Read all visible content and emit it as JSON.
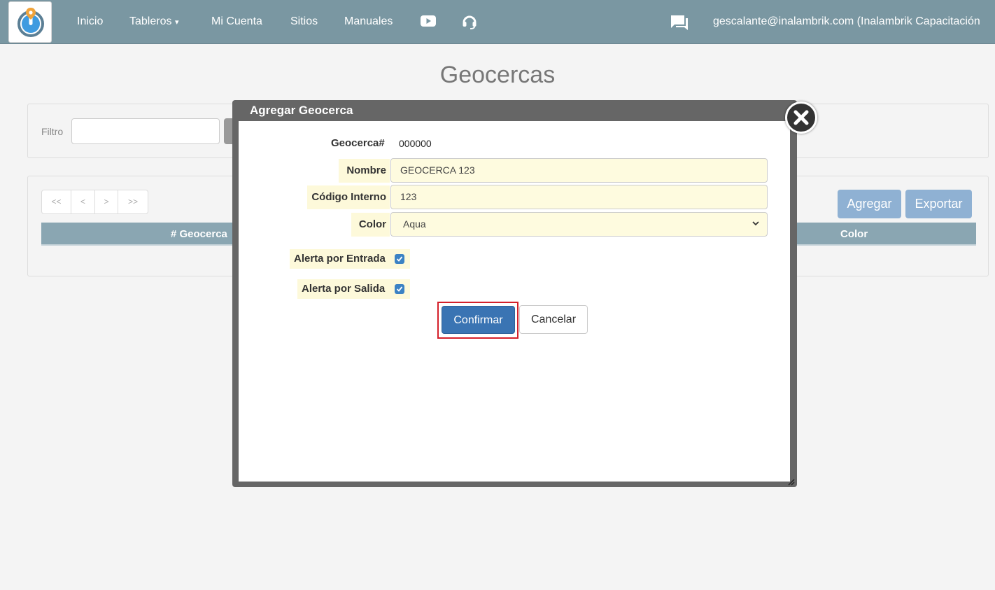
{
  "nav": {
    "items": [
      "Inicio",
      "Tableros",
      "Mi Cuenta",
      "Sitios",
      "Manuales"
    ],
    "user": "gescalante@inalambrik.com (Inalambrik Capacitación"
  },
  "page": {
    "title": "Geocercas",
    "filter_label": "Filtro",
    "pager": [
      "<<",
      "<",
      ">",
      ">>"
    ],
    "add_label": "Agregar",
    "export_label": "Exportar",
    "columns": [
      "# Geocerca",
      "Color"
    ]
  },
  "modal": {
    "title": "Agregar Geocerca",
    "geocerca_label": "Geocerca#",
    "geocerca_value": "000000",
    "nombre_label": "Nombre",
    "nombre_value": "GEOCERCA 123",
    "codigo_label": "Código Interno",
    "codigo_value": "123",
    "color_label": "Color",
    "color_value": "Aqua",
    "alerta_entrada_label": "Alerta por Entrada",
    "alerta_salida_label": "Alerta por Salida",
    "alerta_entrada_checked": true,
    "alerta_salida_checked": true,
    "confirm_label": "Confirmar",
    "cancel_label": "Cancelar"
  },
  "colors": {
    "navbar": "#7a97a2",
    "primary": "#3a74b3",
    "highlight": "#d4202a"
  }
}
